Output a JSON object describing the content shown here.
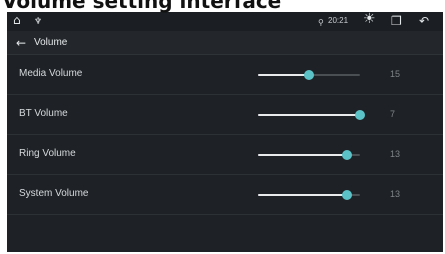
{
  "caption": "Volume setting interface",
  "status_bar": {
    "time": "20:21",
    "icons": [
      "home-icon",
      "usb-icon",
      "location-icon",
      "brightness-icon",
      "windows-icon",
      "back-icon"
    ]
  },
  "header": {
    "title": "Volume"
  },
  "volume_rows": [
    {
      "label": "Media Volume",
      "value": "15",
      "level": 0.5
    },
    {
      "label": "BT Volume",
      "value": "7",
      "level": 1.0
    },
    {
      "label": "Ring Volume",
      "value": "13",
      "level": 0.87
    },
    {
      "label": "System Volume",
      "value": "13",
      "level": 0.87
    }
  ],
  "colors": {
    "accent": "#5bc3c7",
    "background": "#1e2226",
    "track": "#4a4f54",
    "fill": "#e8eaec"
  }
}
